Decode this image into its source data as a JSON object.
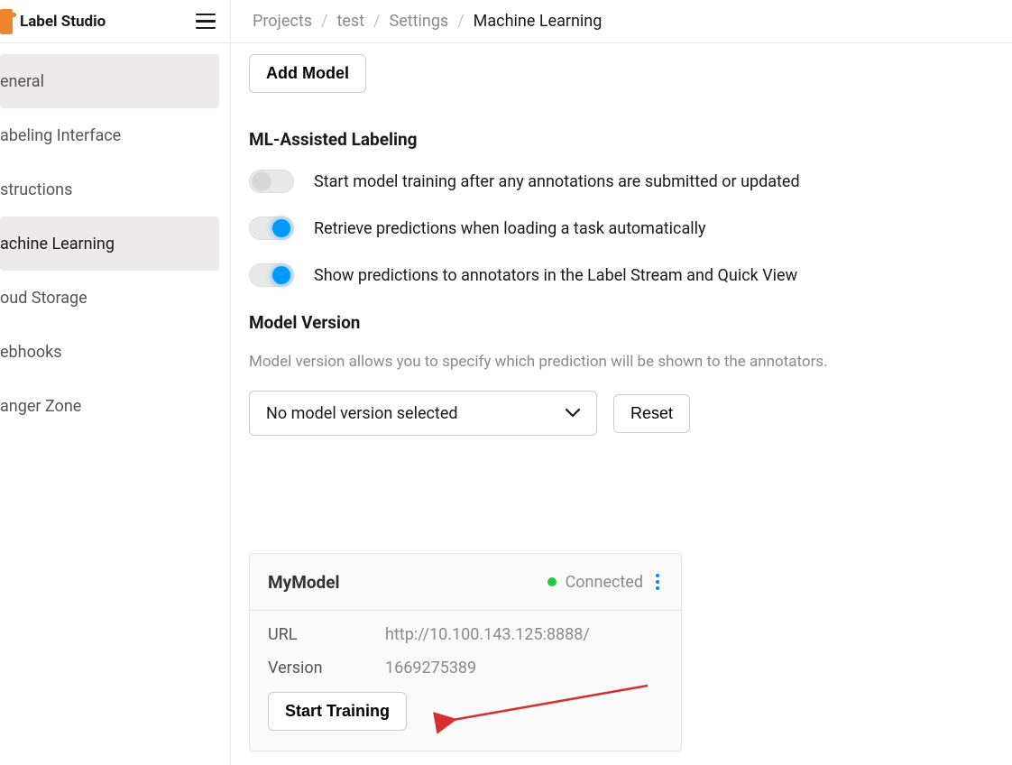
{
  "brand": {
    "title": "Label Studio"
  },
  "breadcrumbs": {
    "items": [
      "Projects",
      "test",
      "Settings"
    ],
    "current": "Machine Learning"
  },
  "sidebar": {
    "items": [
      {
        "label": "eneral"
      },
      {
        "label": "abeling Interface"
      },
      {
        "label": "structions"
      },
      {
        "label": "achine Learning"
      },
      {
        "label": "oud Storage"
      },
      {
        "label": "ebhooks"
      },
      {
        "label": "anger Zone"
      }
    ],
    "activeIndex": 3
  },
  "main": {
    "add_model_label": "Add Model",
    "ml_assisted_heading": "ML-Assisted Labeling",
    "toggles": [
      {
        "on": false,
        "label": "Start model training after any annotations are submitted or updated"
      },
      {
        "on": true,
        "label": "Retrieve predictions when loading a task automatically"
      },
      {
        "on": true,
        "label": "Show predictions to annotators in the Label Stream and Quick View"
      }
    ],
    "model_version_heading": "Model Version",
    "model_version_desc": "Model version allows you to specify which prediction will be shown to the annotators.",
    "model_version_select": "No model version selected",
    "reset_label": "Reset",
    "model_card": {
      "title": "MyModel",
      "status": "Connected",
      "url_label": "URL",
      "url_value": "http://10.100.143.125:8888/",
      "version_label": "Version",
      "version_value": "1669275389",
      "start_training_label": "Start Training"
    }
  }
}
